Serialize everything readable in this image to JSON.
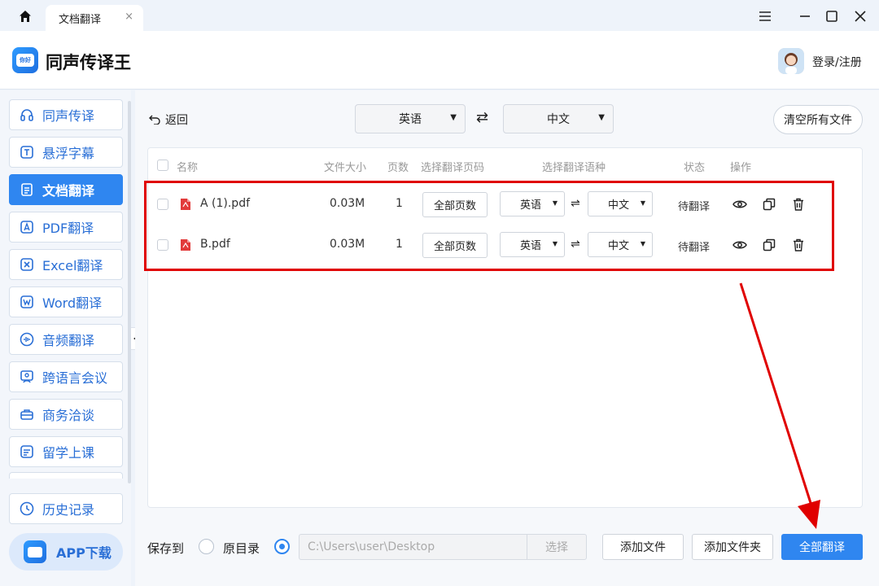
{
  "window": {
    "tab_title": "文档翻译",
    "tab_close": "×"
  },
  "header": {
    "app_title": "同声传译王",
    "login_label": "登录/注册"
  },
  "sidebar": {
    "items": [
      {
        "label": "同声传译",
        "icon": "headphones-icon"
      },
      {
        "label": "悬浮字幕",
        "icon": "text-t-icon"
      },
      {
        "label": "文档翻译",
        "icon": "document-icon",
        "active": true
      },
      {
        "label": "PDF翻译",
        "icon": "pdf-icon"
      },
      {
        "label": "Excel翻译",
        "icon": "excel-icon"
      },
      {
        "label": "Word翻译",
        "icon": "word-icon"
      },
      {
        "label": "音频翻译",
        "icon": "audio-wave-icon"
      },
      {
        "label": "跨语言会议",
        "icon": "meeting-icon"
      },
      {
        "label": "商务洽谈",
        "icon": "briefcase-icon"
      },
      {
        "label": "留学上课",
        "icon": "classroom-icon"
      }
    ],
    "history_label": "历史记录",
    "app_download_label": "APP下载"
  },
  "toolbar": {
    "back_label": "返回",
    "source_lang": "英语",
    "target_lang": "中文",
    "swap_symbol": "⇄",
    "clear_all_label": "清空所有文件"
  },
  "table": {
    "headers": {
      "name": "名称",
      "size": "文件大小",
      "pages": "页数",
      "page_range": "选择翻译页码",
      "language": "选择翻译语种",
      "status": "状态",
      "actions": "操作"
    },
    "rows": [
      {
        "name": "A (1).pdf",
        "size": "0.03M",
        "pages": "1",
        "page_range": "全部页数",
        "src": "英语",
        "dst": "中文",
        "swap": "⇌",
        "status": "待翻译"
      },
      {
        "name": "B.pdf",
        "size": "0.03M",
        "pages": "1",
        "page_range": "全部页数",
        "src": "英语",
        "dst": "中文",
        "swap": "⇌",
        "status": "待翻译"
      }
    ]
  },
  "footer": {
    "save_to_label": "保存到",
    "original_dir_label": "原目录",
    "path_value": "C:\\Users\\user\\Desktop",
    "choose_label": "选择",
    "add_file_label": "添加文件",
    "add_folder_label": "添加文件夹",
    "translate_all_label": "全部翻译"
  },
  "colors": {
    "accent": "#2f86f0",
    "annotation": "#e00000"
  }
}
